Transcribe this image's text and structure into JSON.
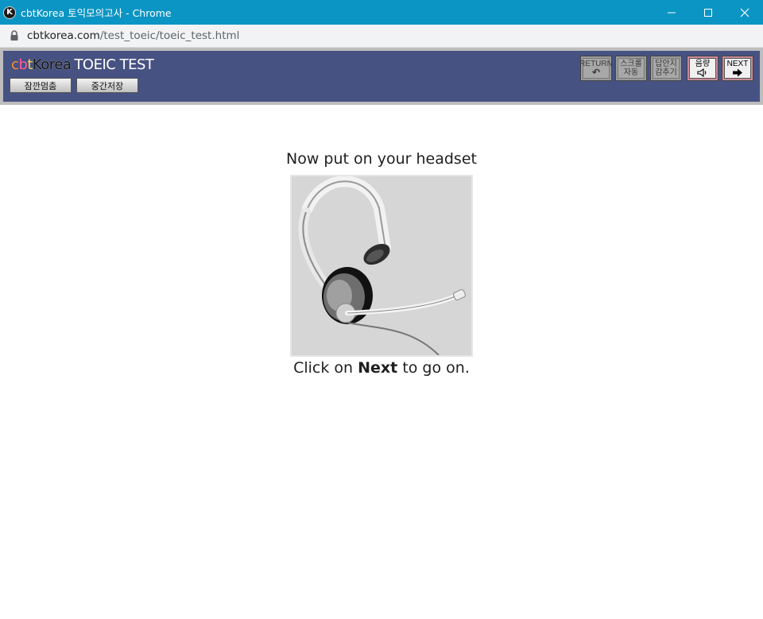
{
  "window": {
    "title": "cbtKorea 토익모의고사 - Chrome",
    "icon_letter": "K"
  },
  "address_bar": {
    "domain": "cbtkorea.com",
    "path": "/test_toeic/toeic_test.html"
  },
  "header": {
    "brand_c": "c",
    "brand_b": "b",
    "brand_t": "t",
    "brand_korea": "Korea",
    "brand_test": "TOEIC TEST",
    "pause_label": "잠깐멈춤",
    "save_label": "중간저장"
  },
  "toolbar": {
    "return_top": "RETURN",
    "return_icon": "↶",
    "scroll_top": "스크롤",
    "scroll_bottom": "자동",
    "hide_top": "답안지",
    "hide_bottom": "감추기",
    "volume_top": "음량",
    "volume_icon": "🔈",
    "next_top": "NEXT",
    "next_icon": "➡"
  },
  "content": {
    "heading": "Now put on your headset",
    "instruction_prefix": "Click on ",
    "instruction_bold": "Next",
    "instruction_suffix": " to go on."
  }
}
